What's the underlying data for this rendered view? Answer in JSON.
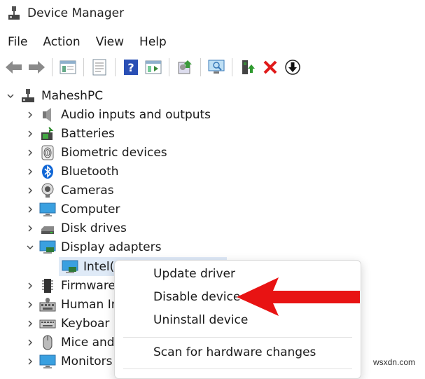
{
  "window": {
    "title": "Device Manager"
  },
  "menu": [
    "File",
    "Action",
    "View",
    "Help"
  ],
  "toolbar": {
    "buttons": [
      "back-icon",
      "forward-icon",
      "properties-icon",
      "scan-icon",
      "help-icon",
      "show-hide-icon",
      "update-driver-icon",
      "monitor-scan-icon",
      "enable-device-icon",
      "uninstall-icon",
      "disable-icon"
    ]
  },
  "tree": {
    "root": "MaheshPC",
    "nodes": [
      "Audio inputs and outputs",
      "Batteries",
      "Biometric devices",
      "Bluetooth",
      "Cameras",
      "Computer",
      "Disk drives",
      "Display adapters",
      "Intel(",
      "Firmware",
      "Human In",
      "Keyboar",
      "Mice and",
      "Monitors"
    ]
  },
  "context_menu": {
    "items": [
      "Update driver",
      "Disable device",
      "Uninstall device",
      "Scan for hardware changes"
    ]
  },
  "watermark": "wsxdn.com",
  "colors": {
    "arrow": "#e81313",
    "selection": "#dfeaf7",
    "accent": "#0b63c5"
  }
}
